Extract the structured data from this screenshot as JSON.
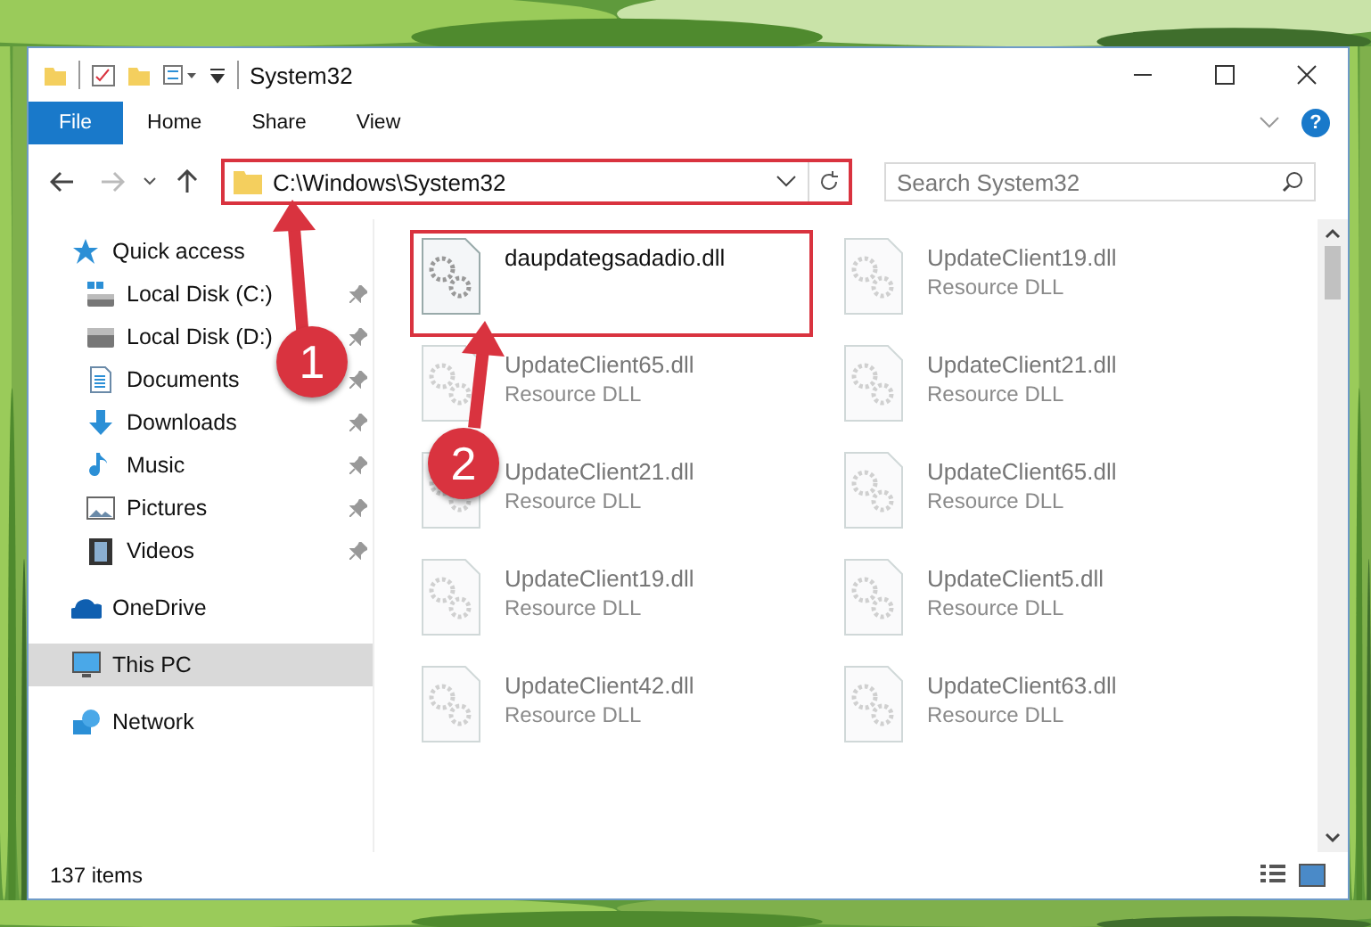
{
  "window": {
    "title": "System32"
  },
  "ribbon": {
    "tabs": [
      {
        "label": "File",
        "kind": "file",
        "selected": false
      },
      {
        "label": "Home",
        "kind": "tab",
        "selected": false
      },
      {
        "label": "Share",
        "kind": "tab",
        "selected": false
      },
      {
        "label": "View",
        "kind": "tab",
        "selected": false
      }
    ],
    "help": "?"
  },
  "address": {
    "path": "C:\\Windows\\System32",
    "highlighted": true
  },
  "search": {
    "placeholder": "Search System32"
  },
  "sidebar": {
    "items": [
      {
        "label": "Quick access",
        "kind": "star",
        "selected": false,
        "children": [
          {
            "label": "Local Disk (C:)",
            "kind": "system-drive",
            "selected": false,
            "pinned": true
          },
          {
            "label": "Local Disk (D:)",
            "kind": "drive",
            "selected": false,
            "pinned": true
          },
          {
            "label": "Documents",
            "kind": "documents",
            "selected": false,
            "pinned": true
          },
          {
            "label": "Downloads",
            "kind": "downloads",
            "selected": false,
            "pinned": true
          },
          {
            "label": "Music",
            "kind": "music",
            "selected": false,
            "pinned": true
          },
          {
            "label": "Pictures",
            "kind": "pictures",
            "selected": false,
            "pinned": true
          },
          {
            "label": "Videos",
            "kind": "videos",
            "selected": false,
            "pinned": true
          }
        ]
      },
      {
        "label": "OneDrive",
        "kind": "cloud",
        "selected": false
      },
      {
        "label": "This PC",
        "kind": "pc",
        "selected": true
      },
      {
        "label": "Network",
        "kind": "network",
        "selected": false
      }
    ]
  },
  "files": [
    {
      "name": "daupdategsadadio.dll",
      "blurred": false,
      "highlighted": true
    },
    {
      "name": "UpdateClient19.dll",
      "type": "Resource DLL",
      "blurred": true,
      "highlighted": false
    },
    {
      "name": "UpdateClient65.dll",
      "type": "Resource DLL",
      "blurred": true,
      "highlighted": false
    },
    {
      "name": "UpdateClient21.dll",
      "type": "Resource DLL",
      "blurred": true,
      "highlighted": false
    },
    {
      "name": "UpdateClient21.dll",
      "type": "Resource DLL",
      "blurred": true,
      "highlighted": false
    },
    {
      "name": "UpdateClient65.dll",
      "type": "Resource DLL",
      "blurred": true,
      "highlighted": false
    },
    {
      "name": "UpdateClient19.dll",
      "type": "Resource DLL",
      "blurred": true,
      "highlighted": false
    },
    {
      "name": "UpdateClient5.dll",
      "type": "Resource DLL",
      "blurred": true,
      "highlighted": false
    },
    {
      "name": "UpdateClient42.dll",
      "type": "Resource DLL",
      "blurred": true,
      "highlighted": false
    },
    {
      "name": "UpdateClient63.dll",
      "type": "Resource DLL",
      "blurred": true,
      "highlighted": false
    }
  ],
  "status_bar": {
    "count": "137 items"
  },
  "annotations": [
    {
      "label": "1"
    },
    {
      "label": "2"
    }
  ]
}
